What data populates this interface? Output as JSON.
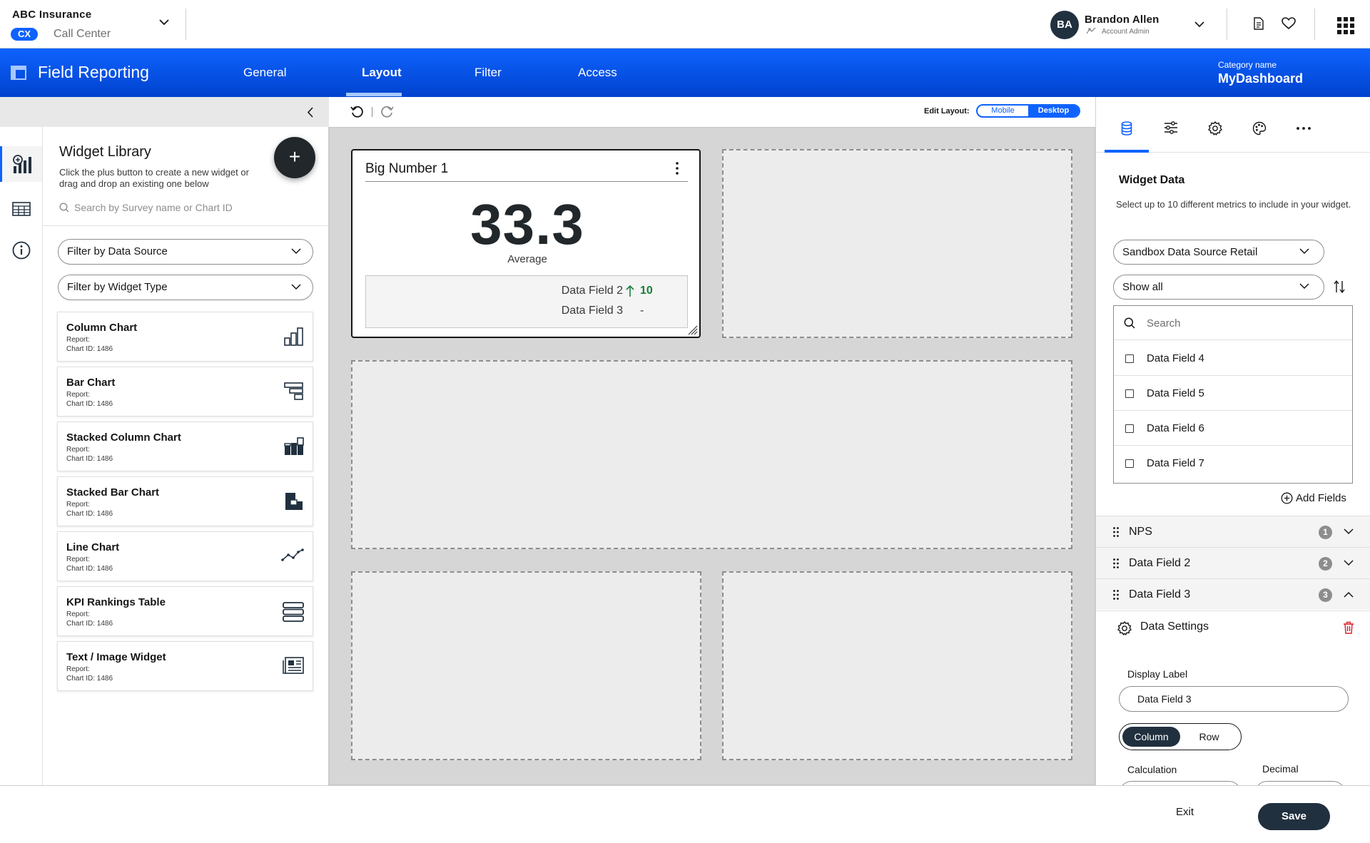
{
  "org": {
    "name": "ABC Insurance",
    "badge": "CX",
    "subtitle": "Call Center"
  },
  "user": {
    "initials": "BA",
    "name": "Brandon Allen",
    "role": "Account Admin"
  },
  "header": {
    "app_title": "Field Reporting",
    "tabs": [
      {
        "label": "General",
        "active": false
      },
      {
        "label": "Layout",
        "active": true
      },
      {
        "label": "Filter",
        "active": false
      },
      {
        "label": "Access",
        "active": false
      }
    ],
    "category_label": "Category name",
    "category_value": "MyDashboard"
  },
  "library": {
    "title": "Widget Library",
    "description": "Click the plus button to create a new widget or drag and drop an existing one below",
    "search_placeholder": "Search by Survey name or Chart ID",
    "filter_source": "Filter by Data Source",
    "filter_type": "Filter by Widget Type",
    "widgets": [
      {
        "title": "Column Chart",
        "report": "Report:",
        "chart_id": "Chart ID: 1486",
        "icon": "column-chart-icon"
      },
      {
        "title": "Bar Chart",
        "report": "Report:",
        "chart_id": "Chart ID: 1486",
        "icon": "bar-chart-icon"
      },
      {
        "title": "Stacked Column Chart",
        "report": "Report:",
        "chart_id": "Chart ID: 1486",
        "icon": "stacked-column-chart-icon"
      },
      {
        "title": "Stacked Bar Chart",
        "report": "Report:",
        "chart_id": "Chart ID: 1486",
        "icon": "stacked-bar-chart-icon"
      },
      {
        "title": "Line Chart",
        "report": "Report:",
        "chart_id": "Chart ID: 1486",
        "icon": "line-chart-icon"
      },
      {
        "title": "KPI Rankings Table",
        "report": "Report:",
        "chart_id": "Chart ID: 1486",
        "icon": "kpi-table-icon"
      },
      {
        "title": "Text / Image Widget",
        "report": "Report:",
        "chart_id": "Chart ID: 1486",
        "icon": "text-image-icon"
      }
    ]
  },
  "canvas": {
    "edit_layout_label": "Edit Layout:",
    "layout_options": [
      "Mobile",
      "Desktop"
    ],
    "layout_selected": "Desktop",
    "big_number": {
      "title": "Big Number 1",
      "value": "33.3",
      "caption": "Average",
      "fields": [
        {
          "label": "Data Field 2",
          "value": "10",
          "trend": "up"
        },
        {
          "label": "Data Field 3",
          "value": "-"
        }
      ]
    }
  },
  "panel": {
    "tabs": [
      "data-icon",
      "sliders-icon",
      "gear-icon",
      "palette-icon",
      "more-icon"
    ],
    "title": "Widget Data",
    "description": "Select up to 10 different metrics to include in your widget.",
    "data_source": "Sandbox Data Source Retail",
    "show_filter": "Show all",
    "search_placeholder": "Search",
    "options": [
      "Data Field 4",
      "Data Field 5",
      "Data Field 6",
      "Data Field 7"
    ],
    "add_fields": "Add Fields",
    "selected_fields": [
      {
        "label": "NPS",
        "order": "1",
        "expanded": false
      },
      {
        "label": "Data Field 2",
        "order": "2",
        "expanded": false
      },
      {
        "label": "Data Field 3",
        "order": "3",
        "expanded": true
      }
    ],
    "settings": {
      "title": "Data Settings",
      "display_label": "Display Label",
      "display_value": "Data Field 3",
      "orientation_options": [
        "Column",
        "Row"
      ],
      "orientation_selected": "Column",
      "calculation_label": "Calculation",
      "decimal_label": "Decimal"
    }
  },
  "footer": {
    "exit": "Exit",
    "save": "Save"
  },
  "colors": {
    "primary": "#0f62fe",
    "primary_dark": "#0043ce",
    "dark": "#21303f",
    "positive": "#198038",
    "danger": "#da1e28"
  }
}
